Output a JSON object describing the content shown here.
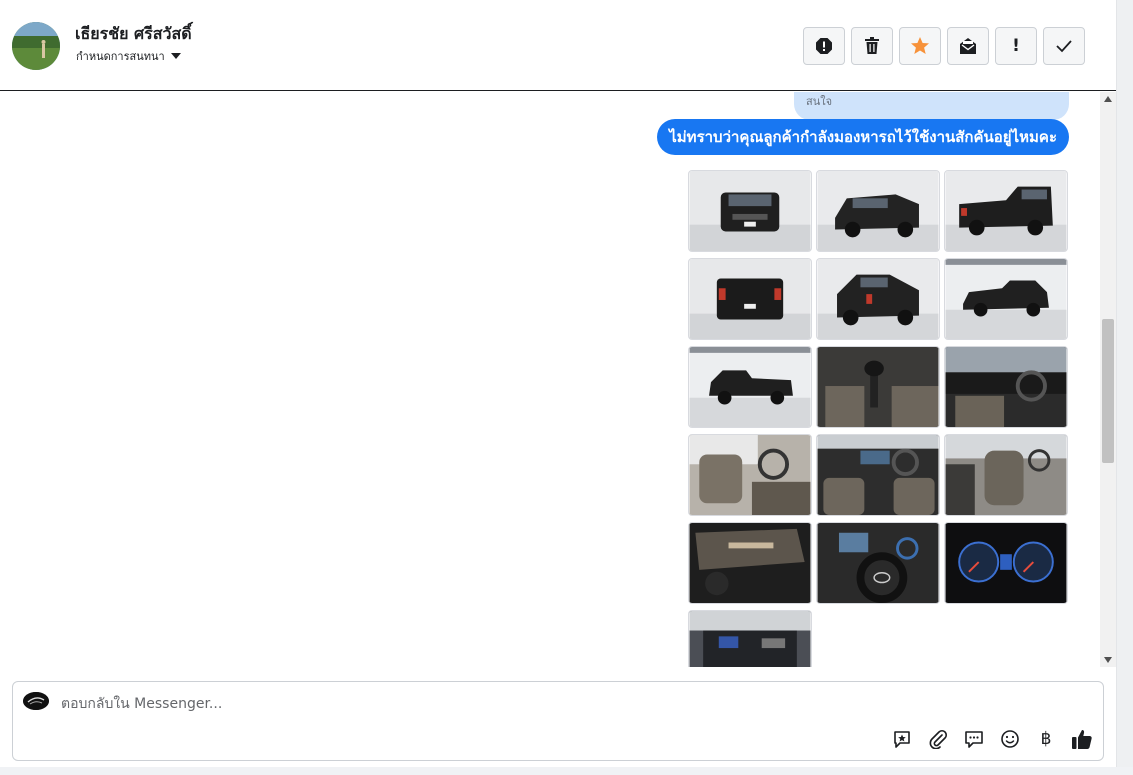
{
  "header": {
    "contact_name": "เธียรชัย ศรีสวัสดิ์",
    "assign_label": "กำหนดการสนทนา",
    "actions": [
      {
        "name": "report-icon"
      },
      {
        "name": "trash-icon"
      },
      {
        "name": "star-icon",
        "color": "#f7923a"
      },
      {
        "name": "mark-unread-icon"
      },
      {
        "name": "exclamation-icon",
        "text": "!"
      },
      {
        "name": "check-icon"
      }
    ]
  },
  "messages": {
    "previous_text": "สนใจ",
    "outgoing_text": "ไม่ทราบว่าคุณลูกค้ากำลังมองหารถไว้ใช้งานสักคันอยู่ไหมคะ",
    "bubble_color": "#1877f2",
    "photo_count": 16
  },
  "composer": {
    "placeholder": "ตอบกลับใน Messenger...",
    "tools": [
      "saved-reply-icon",
      "paperclip-icon",
      "chat-bubbles-icon",
      "smiley-icon",
      "baht-icon",
      "thumbs-up-icon"
    ],
    "baht_symbol": "฿"
  }
}
